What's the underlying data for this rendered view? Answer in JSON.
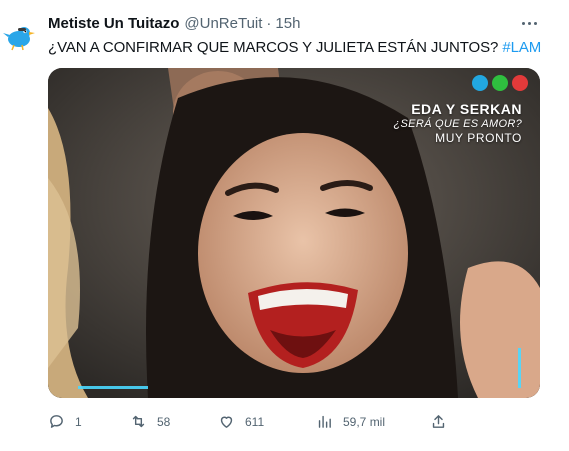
{
  "tweet": {
    "display_name": "Metiste Un Tuitazo",
    "handle": "@UnReTuit",
    "separator": "·",
    "time": "15h",
    "text": "¿VAN A CONFIRMAR QUE MARCOS Y JULIETA ESTÁN JUNTOS?",
    "hashtag": "#LAM"
  },
  "media": {
    "promo_title": "EDA Y SERKAN",
    "promo_subtitle": "¿SERÁ QUE ES AMOR?",
    "promo_soon": "MUY PRONTO"
  },
  "actions": {
    "replies": "1",
    "retweets": "58",
    "likes": "611",
    "views": "59,7 mil"
  },
  "icons": [
    "avatar",
    "more-icon",
    "reply-icon",
    "retweet-icon",
    "like-icon",
    "views-icon",
    "share-icon"
  ],
  "colors": {
    "accent": "#1d9bf0",
    "secondary_text": "#536471",
    "primary_text": "#0f1419"
  }
}
